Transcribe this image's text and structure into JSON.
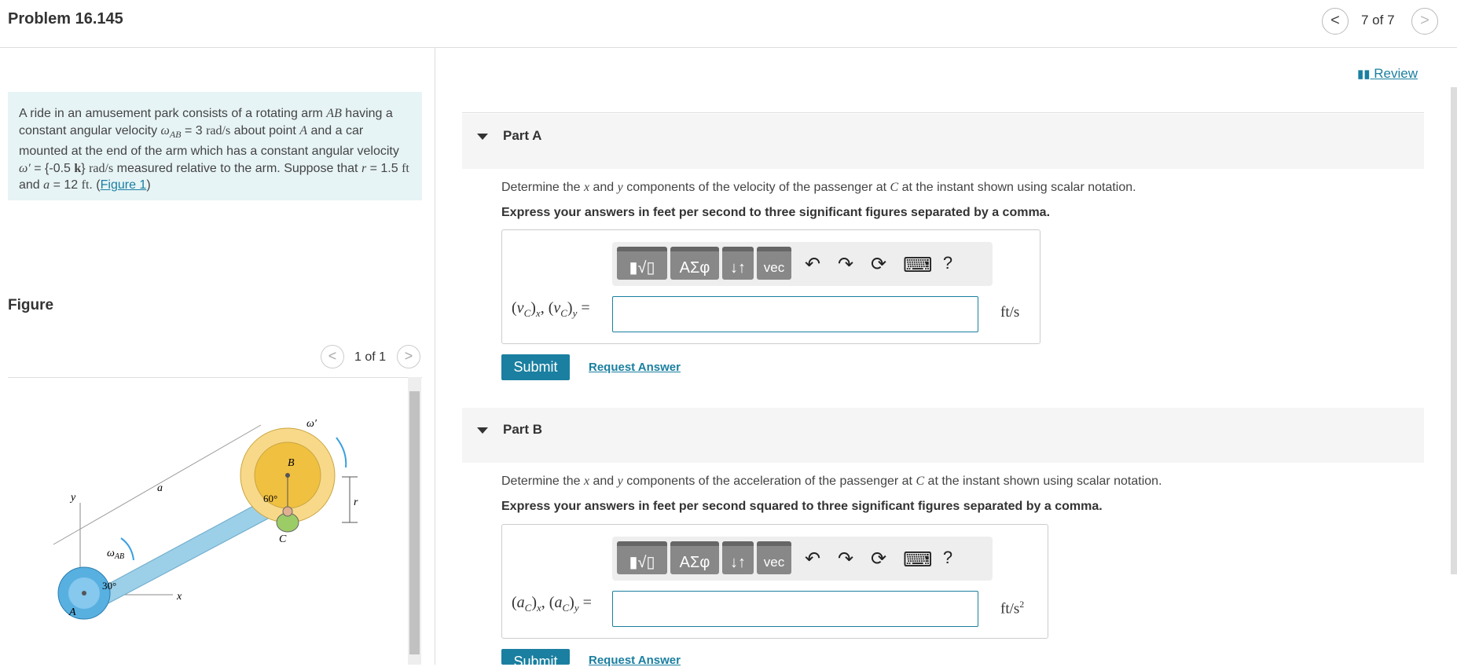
{
  "header": {
    "title": "Problem 16.145",
    "prev_label": "<",
    "next_label": ">",
    "pager": "7 of 7"
  },
  "problem": {
    "t1": "A ride in an amusement park consists of a rotating arm ",
    "t2": "AB",
    "t3": " having a constant angular velocity ",
    "t4": "ω",
    "t4sub": "AB",
    "t5": " = 3 ",
    "t6": "rad/s",
    "t7": " about point ",
    "t8": "A",
    "t9": " and a car mounted at the end of the arm which has a constant angular velocity ",
    "t10": "ω′",
    "t11": " = {-0.5 ",
    "t12": "k",
    "t13": "} ",
    "t14": "rad/s",
    "t15": " measured relative to the arm. Suppose that ",
    "t16": "r",
    "t17": " = 1.5 ",
    "t18": "ft",
    "t19": " and ",
    "t20": "a",
    "t21": " = 12 ",
    "t22": "ft",
    "t23": ". (",
    "link": "Figure 1",
    "t24": ")"
  },
  "figure": {
    "heading": "Figure",
    "counter": "1 of 1",
    "prev": "<",
    "next": ">",
    "labels": {
      "y": "y",
      "x": "x",
      "a": "a",
      "A": "A",
      "B": "B",
      "C": "C",
      "r": "r",
      "wab": "ω",
      "wabsub": "AB",
      "wprime": "ω′",
      "ang30": "30°",
      "ang60": "60°"
    },
    "colors": {
      "arm": "#9ccfe8",
      "hub": "#58b0e0",
      "car_outer": "#f8d98a",
      "car_inner": "#f0c040"
    }
  },
  "review": "Review",
  "partA": {
    "title": "Part A",
    "q1": "Determine the ",
    "qx": "x",
    "q2": " and ",
    "qy": "y",
    "q3": " components of the velocity of the passenger at ",
    "qC": "C",
    "q4": " at the instant shown using scalar notation.",
    "instruction": "Express your answers in feet per second to three significant figures separated by a comma.",
    "label_v": "v",
    "sub": "C",
    "sx": "x",
    "sy": "y",
    "eq": " =",
    "unit": "ft/s",
    "submit": "Submit",
    "request": "Request Answer"
  },
  "partB": {
    "title": "Part B",
    "q1": "Determine the ",
    "qx": "x",
    "q2": " and ",
    "qy": "y",
    "q3": " components of the acceleration of the passenger at ",
    "qC": "C",
    "q4": " at the instant shown using scalar notation.",
    "instruction": "Express your answers in feet per second squared to three significant figures separated by a comma.",
    "label_a": "a",
    "sub": "C",
    "sx": "x",
    "sy": "y",
    "eq": " =",
    "unit": "ft/s",
    "unit_sup": "2",
    "submit": "Submit",
    "request": "Request Answer"
  },
  "toolbar": {
    "templates": "▮√▯",
    "greek": "ΑΣφ",
    "arrows": "↓↑",
    "vec": "vec",
    "undo": "↶",
    "redo": "↷",
    "reset": "⟳",
    "keyboard": "⌨",
    "help": "?"
  }
}
